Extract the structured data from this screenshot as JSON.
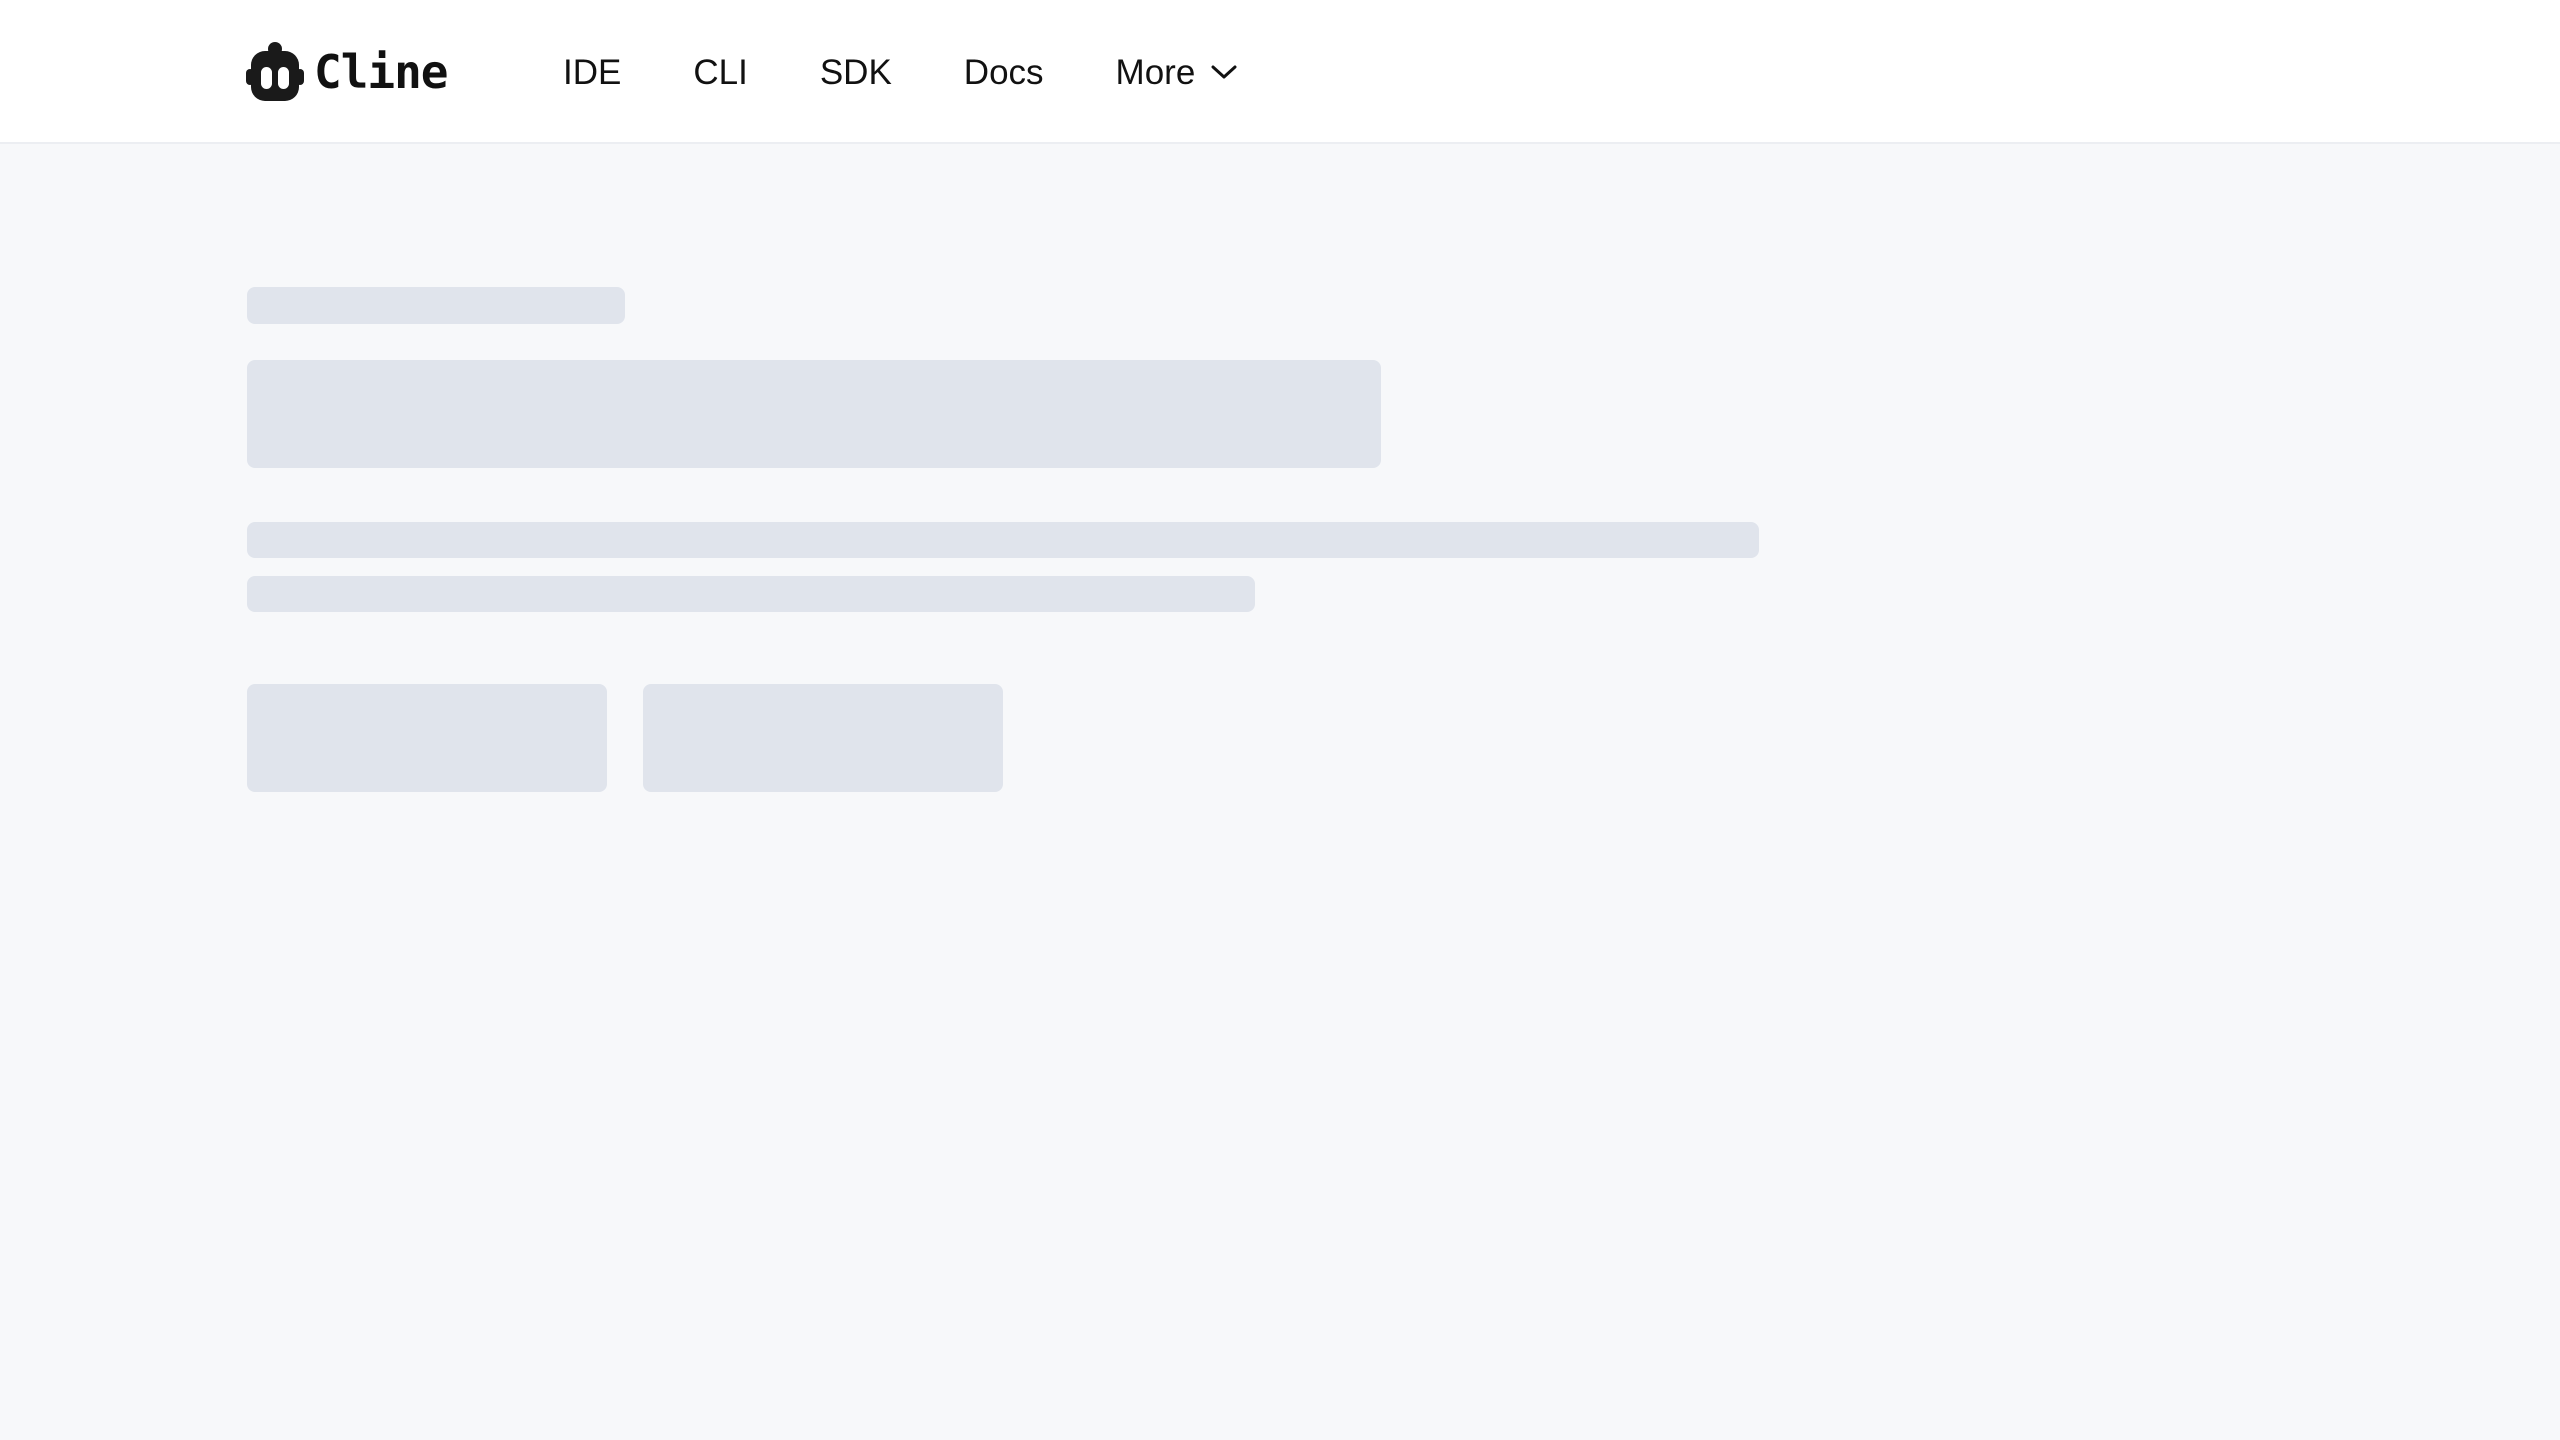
{
  "brand": {
    "name": "Cline",
    "icon": "robot-head-icon"
  },
  "nav": {
    "items": [
      {
        "label": "IDE"
      },
      {
        "label": "CLI"
      },
      {
        "label": "SDK"
      },
      {
        "label": "Docs"
      }
    ],
    "more": {
      "label": "More",
      "icon": "chevron-down-icon"
    }
  },
  "colors": {
    "header_bg": "#ffffff",
    "page_bg": "#f7f8fa",
    "skeleton": "#e0e4ec",
    "text": "#111111"
  }
}
